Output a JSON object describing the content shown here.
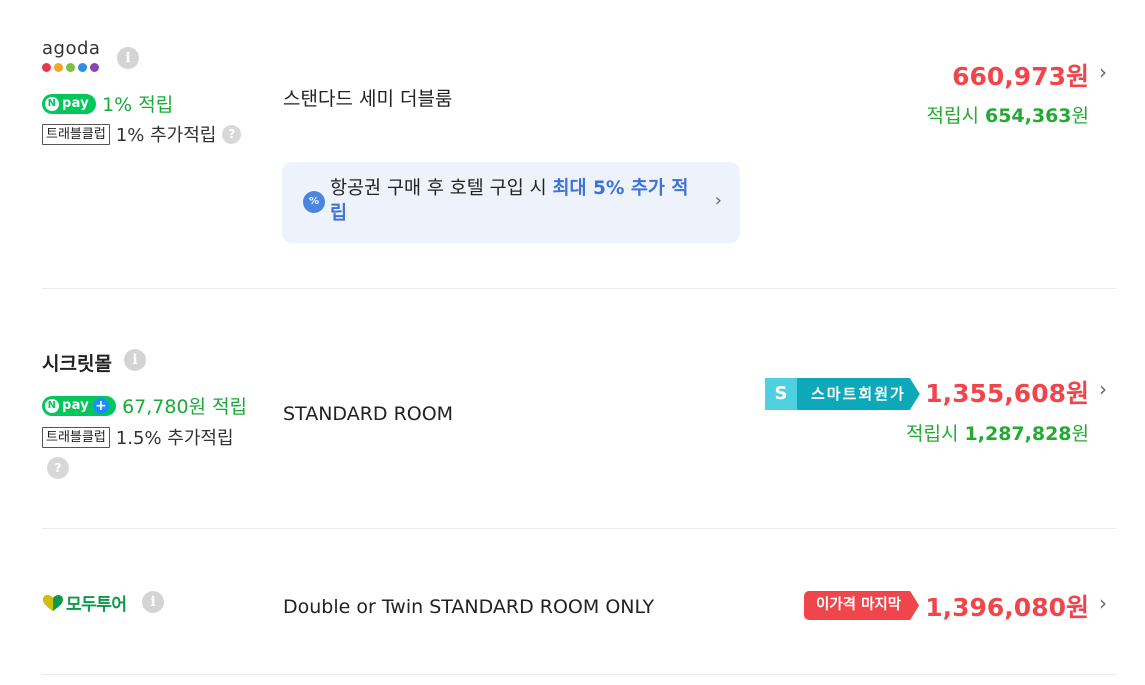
{
  "offers": [
    {
      "vendor": "agoda",
      "vendor_logo_colors": [
        "#e53945",
        "#f5a623",
        "#7ac143",
        "#2f8ee0",
        "#8e44ad"
      ],
      "npay_text": "1% 적립",
      "club_badge": "트래블클럽",
      "club_text": "1% 추가적립",
      "room_name": "스탠다드 세미 더블룸",
      "promo": {
        "text_prefix": "항공권 구매 후 호텔 구입 시 ",
        "text_highlight": "최대 5% 추가 적립"
      },
      "price": "660,973원",
      "reward_prefix": "적립시 ",
      "reward_amount": "654,363",
      "reward_suffix": "원"
    },
    {
      "vendor": "시크릿몰",
      "npay_text": "67,780원 적립",
      "club_badge": "트래블클럽",
      "club_text": "1.5% 추가적립",
      "room_name": "STANDARD ROOM",
      "tag_s": "S",
      "tag_label": "스마트회원가",
      "price": "1,355,608원",
      "reward_prefix": "적립시 ",
      "reward_amount": "1,287,828",
      "reward_suffix": "원"
    },
    {
      "vendor": "모두투어",
      "room_name": "Double or Twin STANDARD ROOM ONLY",
      "tag_label": "이가격 마지막",
      "price": "1,396,080원"
    }
  ],
  "npay_badge": "pay",
  "colors": {
    "price": "#f0464b",
    "reward": "#22aa33",
    "npay": "#03c75a",
    "smart": "#0da8b9"
  },
  "icons": {
    "info": "info-icon",
    "help": "help-icon",
    "chevron": "chevron-right-icon"
  }
}
